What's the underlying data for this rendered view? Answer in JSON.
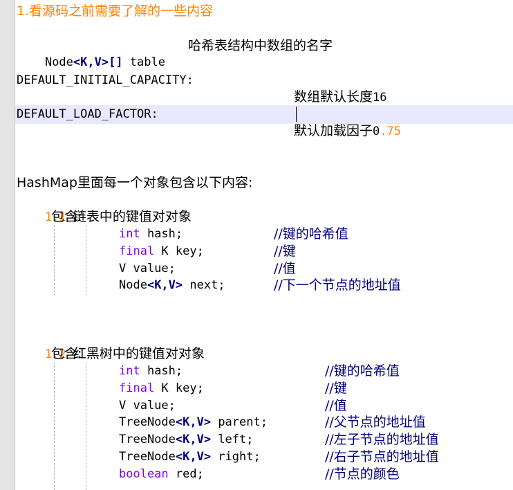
{
  "editor": {
    "heading": "1.看源码之前需要了解的一些内容",
    "table_line": {
      "type_a": "Node",
      "type_b": "<K,V>[]",
      "name": " table",
      "desc": "哈希表结构中数组的名字"
    },
    "capacity_line": {
      "name": "DEFAULT_INITIAL_CAPACITY:",
      "desc": "数组默认长度",
      "num": "16"
    },
    "load_line": {
      "name": "DEFAULT_LOAD_FACTOR:",
      "desc": "默认加载因子",
      "num_a": "0",
      "num_b": ".75"
    },
    "hashmap_intro": "HashMap里面每一个对象包含以下内容:",
    "section1": {
      "num": "1.1",
      "title": "链表中的键值对对象",
      "contains": "包含:",
      "fields": [
        {
          "kw": "int",
          "rest": " hash;",
          "comment": "//键的哈希值"
        },
        {
          "kw": "final",
          "rest": " K key;",
          "comment": "//键"
        },
        {
          "plain": "V value;",
          "comment": "//值"
        },
        {
          "type_a": "Node",
          "type_b": "<K,V>",
          "rest": " next;",
          "comment": "//下一个节点的地址值"
        }
      ]
    },
    "section2": {
      "num": "1.2",
      "title": "红黑树中的键值对对象",
      "contains": "包含:",
      "fields": [
        {
          "kw": "int",
          "rest": " hash;",
          "comment": "//键的哈希值"
        },
        {
          "kw": "final",
          "rest": " K key;",
          "comment": "//键"
        },
        {
          "plain": "V value;",
          "comment": "//值"
        },
        {
          "type_a": "TreeNode",
          "type_b": "<K,V>",
          "rest": " parent;",
          "comment": "//父节点的地址值"
        },
        {
          "type_a": "TreeNode",
          "type_b": "<K,V>",
          "rest": " left;",
          "comment": "//左子节点的地址值"
        },
        {
          "type_a": "TreeNode",
          "type_b": "<K,V>",
          "rest": " right;",
          "comment": "//右子节点的地址值"
        },
        {
          "kw": "boolean",
          "rest": " red;",
          "comment": "//节点的颜色"
        }
      ]
    }
  }
}
